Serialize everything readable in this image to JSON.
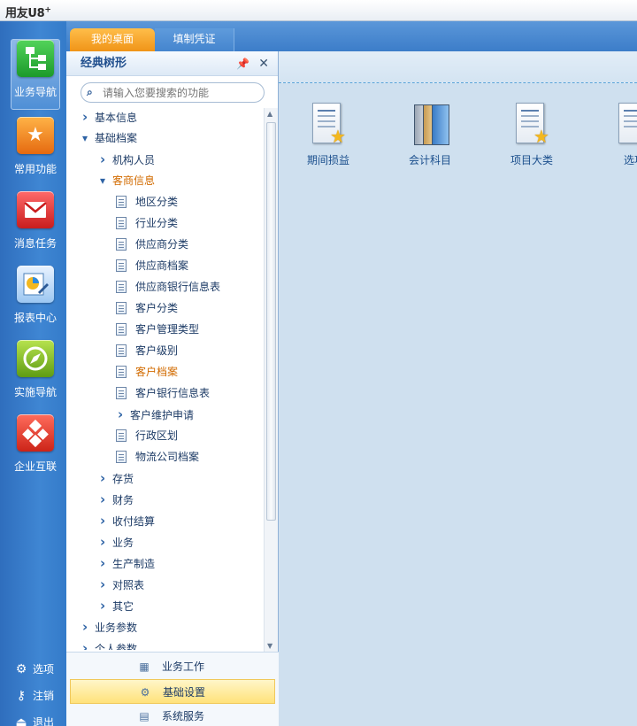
{
  "app": {
    "title": "用友U8",
    "title_sup": "+"
  },
  "nav": {
    "items": [
      {
        "label": "业务导航",
        "icon": "tree-icon"
      },
      {
        "label": "常用功能",
        "icon": "star-icon"
      },
      {
        "label": "消息任务",
        "icon": "envelope-icon"
      },
      {
        "label": "报表中心",
        "icon": "report-icon"
      },
      {
        "label": "实施导航",
        "icon": "compass-icon"
      },
      {
        "label": "企业互联",
        "icon": "connect-icon"
      }
    ],
    "bottom": [
      {
        "label": "选项",
        "icon": "gear-icon"
      },
      {
        "label": "注销",
        "icon": "key-icon"
      },
      {
        "label": "退出",
        "icon": "exit-icon"
      }
    ]
  },
  "tabs": [
    {
      "label": "我的桌面",
      "active": true
    },
    {
      "label": "填制凭证",
      "active": false
    }
  ],
  "tree_panel": {
    "title": "经典树形",
    "search_placeholder": "请输入您要搜索的功能",
    "nodes": [
      {
        "label": "基本信息",
        "level": 0,
        "state": "collapsed"
      },
      {
        "label": "基础档案",
        "level": 0,
        "state": "expanded"
      },
      {
        "label": "机构人员",
        "level": 1,
        "state": "collapsed"
      },
      {
        "label": "客商信息",
        "level": 1,
        "state": "expanded",
        "highlight": true
      },
      {
        "label": "地区分类",
        "level": 2,
        "state": "leaf"
      },
      {
        "label": "行业分类",
        "level": 2,
        "state": "leaf"
      },
      {
        "label": "供应商分类",
        "level": 2,
        "state": "leaf"
      },
      {
        "label": "供应商档案",
        "level": 2,
        "state": "leaf"
      },
      {
        "label": "供应商银行信息表",
        "level": 2,
        "state": "leaf"
      },
      {
        "label": "客户分类",
        "level": 2,
        "state": "leaf"
      },
      {
        "label": "客户管理类型",
        "level": 2,
        "state": "leaf"
      },
      {
        "label": "客户级别",
        "level": 2,
        "state": "leaf"
      },
      {
        "label": "客户档案",
        "level": 2,
        "state": "leaf",
        "highlight": true
      },
      {
        "label": "客户银行信息表",
        "level": 2,
        "state": "leaf"
      },
      {
        "label": "客户维护申请",
        "level": 2,
        "state": "collapsed"
      },
      {
        "label": "行政区划",
        "level": 2,
        "state": "leaf"
      },
      {
        "label": "物流公司档案",
        "level": 2,
        "state": "leaf"
      },
      {
        "label": "存货",
        "level": 1,
        "state": "collapsed"
      },
      {
        "label": "财务",
        "level": 1,
        "state": "collapsed"
      },
      {
        "label": "收付结算",
        "level": 1,
        "state": "collapsed"
      },
      {
        "label": "业务",
        "level": 1,
        "state": "collapsed"
      },
      {
        "label": "生产制造",
        "level": 1,
        "state": "collapsed"
      },
      {
        "label": "对照表",
        "level": 1,
        "state": "collapsed"
      },
      {
        "label": "其它",
        "level": 1,
        "state": "collapsed"
      },
      {
        "label": "业务参数",
        "level": 0,
        "state": "collapsed"
      },
      {
        "label": "个人参数",
        "level": 0,
        "state": "collapsed"
      }
    ],
    "bottom_menu": [
      {
        "label": "业务工作",
        "icon": "workflow-icon",
        "selected": false
      },
      {
        "label": "基础设置",
        "icon": "gear-icon",
        "selected": true
      },
      {
        "label": "系统服务",
        "icon": "service-icon",
        "selected": false
      }
    ]
  },
  "desktop": {
    "icons": [
      {
        "label": "期间损益",
        "icon": "document-star-icon"
      },
      {
        "label": "会计科目",
        "icon": "books-icon"
      },
      {
        "label": "项目大类",
        "icon": "document-star-icon"
      },
      {
        "label": "选项",
        "icon": "document-star-icon"
      }
    ]
  },
  "colors": {
    "accent": "#f09418",
    "nav_blue": "#3f86d3",
    "highlight_text": "#d26b00"
  }
}
